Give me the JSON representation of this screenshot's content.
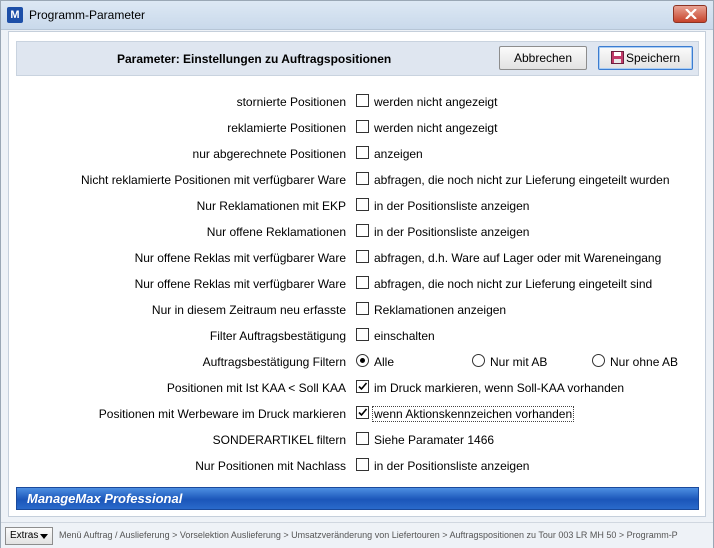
{
  "window": {
    "title": "Programm-Parameter",
    "app_icon_letter": "M"
  },
  "header": {
    "title": "Parameter: Einstellungen zu Auftragspositionen",
    "cancel_label": "Abbrechen",
    "save_label": "Speichern"
  },
  "rows": [
    {
      "label": "stornierte Positionen",
      "option": "werden nicht angezeigt",
      "checked": false
    },
    {
      "label": "reklamierte Positionen",
      "option": "werden nicht angezeigt",
      "checked": false
    },
    {
      "label": "nur abgerechnete Positionen",
      "option": "anzeigen",
      "checked": false
    },
    {
      "label": "Nicht reklamierte Positionen mit verfügbarer Ware",
      "option": "abfragen, die noch nicht zur Lieferung eingeteilt wurden",
      "checked": false
    },
    {
      "label": "Nur Reklamationen mit EKP",
      "option": "in der Positionsliste anzeigen",
      "checked": false
    },
    {
      "label": "Nur offene Reklamationen",
      "option": "in der Positionsliste anzeigen",
      "checked": false
    },
    {
      "label": "Nur offene Reklas mit verfügbarer Ware",
      "option": "abfragen, d.h. Ware auf Lager oder mit Wareneingang",
      "checked": false
    },
    {
      "label": "Nur offene Reklas mit verfügbarer Ware",
      "option": "abfragen, die noch nicht zur Lieferung eingeteilt sind",
      "checked": false
    },
    {
      "label": "Nur in diesem Zeitraum neu erfasste",
      "option": "Reklamationen anzeigen",
      "checked": false
    },
    {
      "label": "Filter Auftragsbestätigung",
      "option": "einschalten",
      "checked": false
    }
  ],
  "radio_row": {
    "label": "Auftragsbestätigung Filtern",
    "options": [
      "Alle",
      "Nur mit AB",
      "Nur ohne AB"
    ],
    "selected": "Alle"
  },
  "rows2": [
    {
      "label": "Positionen mit Ist KAA < Soll KAA",
      "option": "im Druck markieren, wenn Soll-KAA vorhanden",
      "checked": true
    },
    {
      "label": "Positionen mit Werbeware im Druck markieren",
      "option": "wenn Aktionskennzeichen vorhanden",
      "checked": true
    },
    {
      "label": "SONDERARTIKEL filtern",
      "option": "Siehe Paramater 1466",
      "checked": false
    },
    {
      "label": "Nur Positionen mit Nachlass",
      "option": "in der Positionsliste anzeigen",
      "checked": false
    }
  ],
  "footer": {
    "brand": "ManageMax Professional"
  },
  "statusbar": {
    "extras_label": "Extras",
    "breadcrumb": "Menü Auftrag / Auslieferung > Vorselektion Auslieferung > Umsatzveränderung von Liefertouren > Auftragspositionen zu Tour 003 LR MH 50 > Programm-P"
  },
  "colors": {
    "footer_bar": "#1b56b9",
    "header_bg": "#dfe6f0",
    "close_button": "#c7432b"
  }
}
